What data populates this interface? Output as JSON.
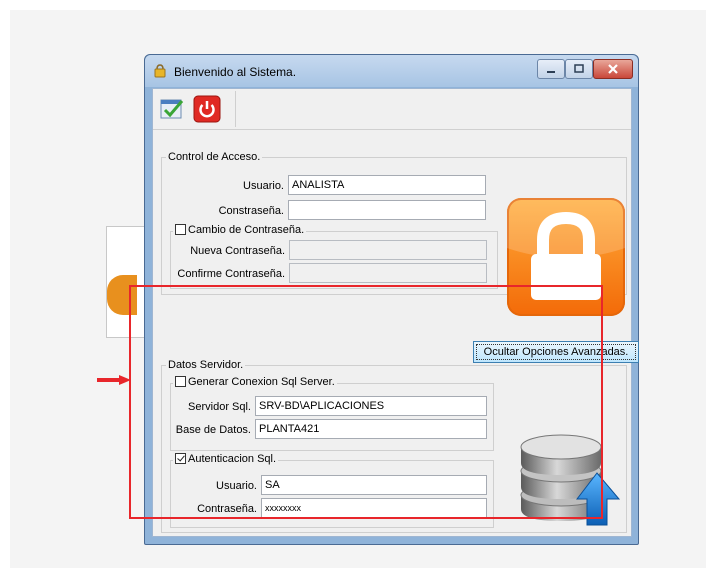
{
  "window": {
    "title": "Bienvenido al Sistema."
  },
  "toolbar": {
    "accept": {
      "icon": "check-list-icon"
    },
    "exit": {
      "icon": "power-icon"
    }
  },
  "access_control": {
    "group_label": "Control de Acceso.",
    "user_label": "Usuario.",
    "user_value": "ANALISTA",
    "password_label": "Constraseña.",
    "password_value": "",
    "change_password": {
      "checkbox_label": "Cambio de Contraseña.",
      "checked": false,
      "new_label": "Nueva Contraseña.",
      "confirm_label": "Confirme Contraseña."
    }
  },
  "advanced_button_label": "Ocultar Opciones Avanzadas.",
  "server": {
    "group_label": "Datos Servidor.",
    "generate": {
      "checkbox_label": "Generar Conexion Sql Server.",
      "checked": false,
      "server_label": "Servidor Sql.",
      "server_value": "SRV-BD\\APLICACIONES",
      "database_label": "Base de Datos.",
      "database_value": "PLANTA421"
    },
    "sql_auth": {
      "checkbox_label": "Autenticacion Sql.",
      "checked": true,
      "user_label": "Usuario.",
      "user_value": "SA",
      "password_label": "Contraseña.",
      "password_value": "xxxxxxxx"
    }
  },
  "colors": {
    "annotation_red": "#e8262b",
    "lock_orange": "#f7890f",
    "db_arrow_blue": "#1e7fd6"
  }
}
